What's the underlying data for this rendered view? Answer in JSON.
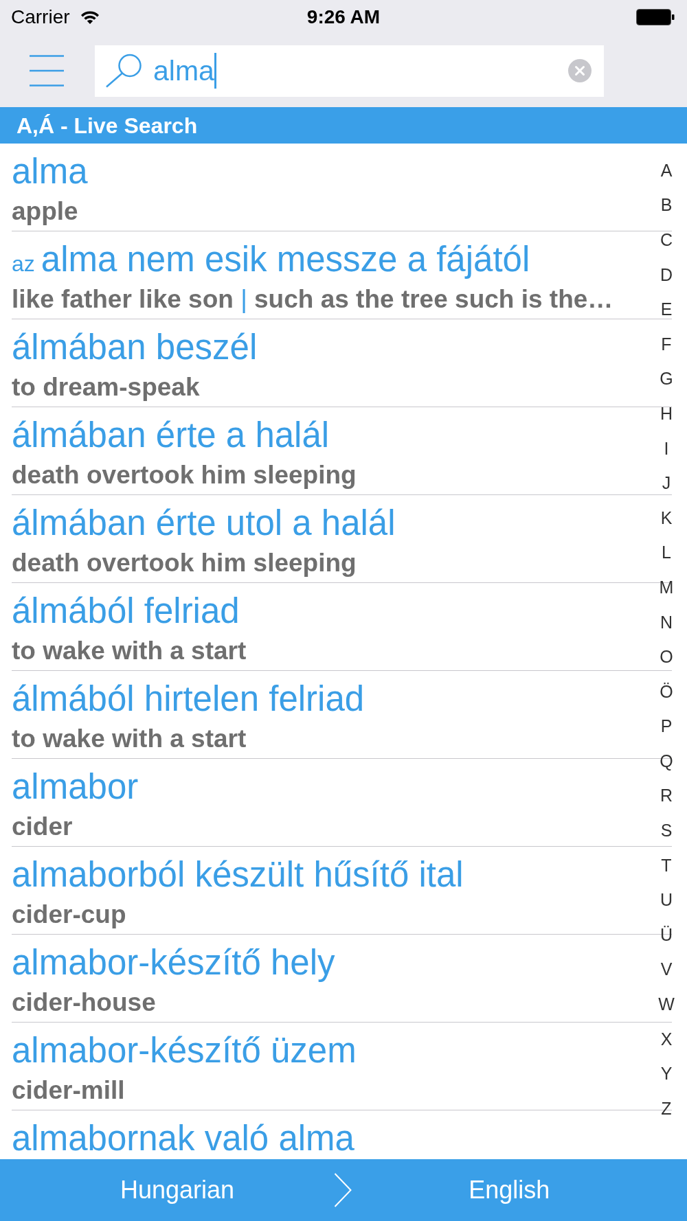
{
  "status_bar": {
    "carrier": "Carrier",
    "time": "9:26 AM"
  },
  "search": {
    "value": "alma",
    "focused": true
  },
  "section_header": "A,Á - Live Search",
  "meaning_separator": "|",
  "entries": [
    {
      "headword": "alma",
      "meanings": [
        "apple"
      ]
    },
    {
      "prefix": "az",
      "headword": "alma nem esik messze a fájától",
      "meanings": [
        "like father like son",
        "such as the tree such is the…"
      ]
    },
    {
      "headword": "álmában beszél",
      "meanings": [
        "to dream-speak"
      ]
    },
    {
      "headword": "álmában érte a halál",
      "meanings": [
        "death overtook him sleeping"
      ]
    },
    {
      "headword": "álmában érte utol a halál",
      "meanings": [
        "death overtook him sleeping"
      ]
    },
    {
      "headword": "álmából felriad",
      "meanings": [
        "to wake with a start"
      ]
    },
    {
      "headword": "álmából hirtelen felriad",
      "meanings": [
        "to wake with a start"
      ]
    },
    {
      "headword": "almabor",
      "meanings": [
        "cider"
      ]
    },
    {
      "headword": "almaborból készült hűsítő ital",
      "meanings": [
        "cider-cup"
      ]
    },
    {
      "headword": "almabor-készítő hely",
      "meanings": [
        "cider-house"
      ]
    },
    {
      "headword": "almabor-készítő üzem",
      "meanings": [
        "cider-mill"
      ]
    },
    {
      "headword": "almabornak való alma"
    }
  ],
  "index_letters": [
    "A",
    "B",
    "C",
    "D",
    "E",
    "F",
    "G",
    "H",
    "I",
    "J",
    "K",
    "L",
    "M",
    "N",
    "O",
    "Ö",
    "P",
    "Q",
    "R",
    "S",
    "T",
    "U",
    "Ü",
    "V",
    "W",
    "X",
    "Y",
    "Z"
  ],
  "language_bar": {
    "source": "Hungarian",
    "target": "English"
  }
}
